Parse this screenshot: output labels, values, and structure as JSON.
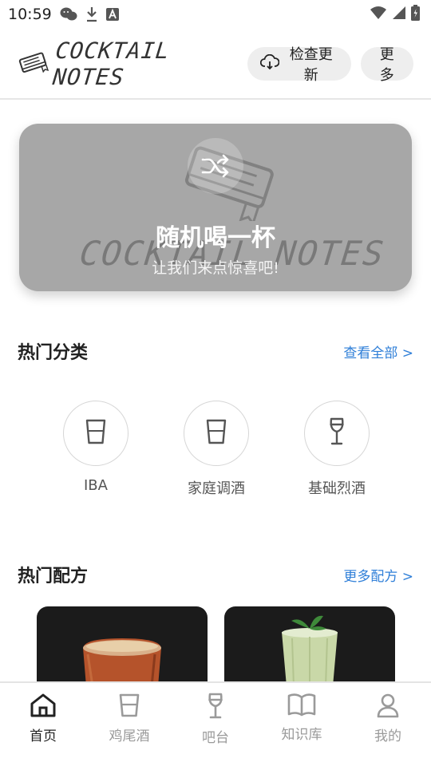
{
  "status_bar": {
    "time": "10:59",
    "icons": [
      "wechat-icon",
      "download-icon",
      "font-app-icon",
      "wifi-icon",
      "signal-icon",
      "battery-icon"
    ]
  },
  "header": {
    "logo_text": "COCKTAIL NOTES",
    "check_update_label": "检查更新",
    "more_label": "更多"
  },
  "banner": {
    "title": "随机喝一杯",
    "subtitle": "让我们来点惊喜吧!",
    "watermark_text": "COCKTAIL NOTES"
  },
  "categories_section": {
    "title": "热门分类",
    "link": "查看全部 >",
    "items": [
      {
        "label": "IBA",
        "icon": "cup-icon"
      },
      {
        "label": "家庭调酒",
        "icon": "cup-icon"
      },
      {
        "label": "基础烈酒",
        "icon": "wine-glass-icon"
      }
    ]
  },
  "recipes_section": {
    "title": "热门配方",
    "link": "更多配方 >"
  },
  "bottom_nav": {
    "tabs": [
      {
        "label": "首页",
        "icon": "home-icon",
        "active": true
      },
      {
        "label": "鸡尾酒",
        "icon": "cup-icon",
        "active": false
      },
      {
        "label": "吧台",
        "icon": "wine-glass-icon",
        "active": false
      },
      {
        "label": "知识库",
        "icon": "book-icon",
        "active": false
      },
      {
        "label": "我的",
        "icon": "person-icon",
        "active": false
      }
    ]
  },
  "colors": {
    "accent_link": "#2f7fd8",
    "banner_bg": "#a7a7a7",
    "pill_bg": "#eeeeee"
  }
}
